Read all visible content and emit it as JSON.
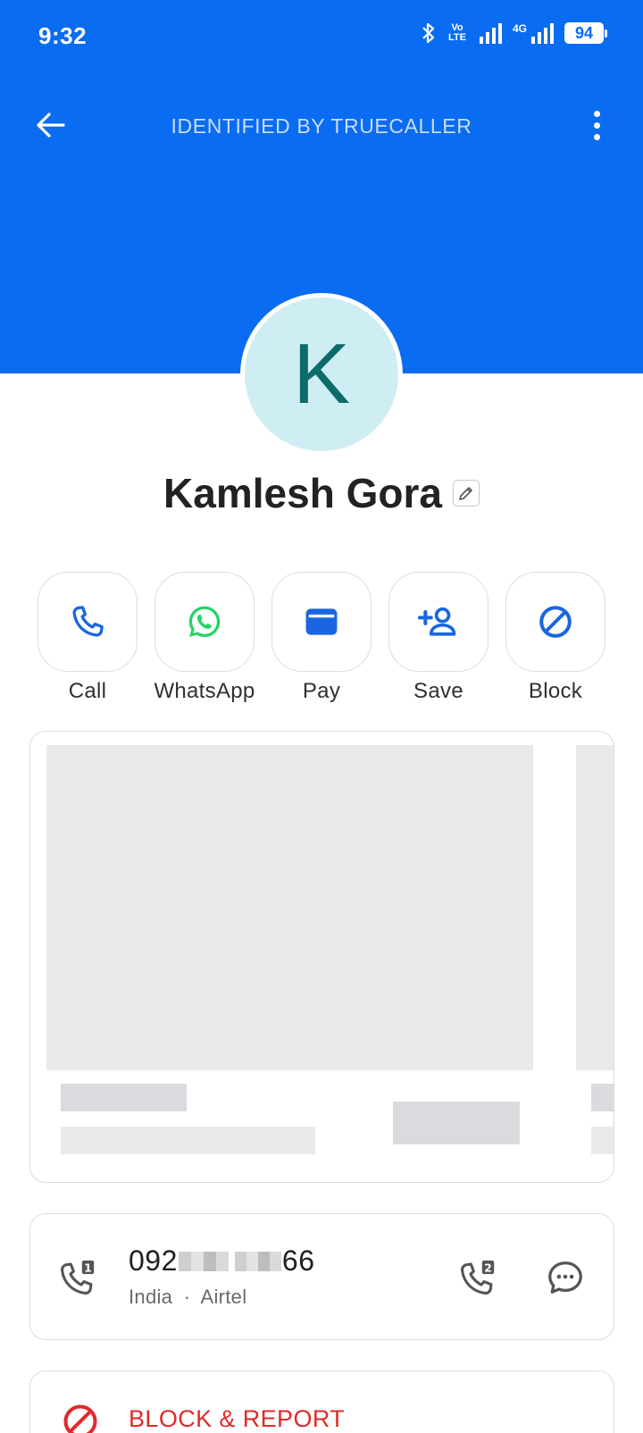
{
  "status_bar": {
    "time": "9:32",
    "battery": "94",
    "volte": "Vo LTE",
    "network": "4G"
  },
  "app_bar": {
    "title": "IDENTIFIED BY TRUECALLER"
  },
  "contact": {
    "initial": "K",
    "name": "Kamlesh Gora"
  },
  "actions": [
    {
      "label": "Call",
      "icon": "phone-icon"
    },
    {
      "label": "WhatsApp",
      "icon": "whatsapp-icon"
    },
    {
      "label": "Pay",
      "icon": "wallet-icon"
    },
    {
      "label": "Save",
      "icon": "add-contact-icon"
    },
    {
      "label": "Block",
      "icon": "block-icon"
    }
  ],
  "phone": {
    "prefix": "092",
    "suffix": "66",
    "country": "India",
    "separator": "·",
    "carrier": "Airtel",
    "sim1_badge": "1",
    "sim2_badge": "2"
  },
  "report": {
    "label": "BLOCK & REPORT"
  },
  "colors": {
    "header": "#0a6cf0",
    "accent": "#1a66e0",
    "whatsapp": "#25d366",
    "danger": "#e02a2a"
  }
}
